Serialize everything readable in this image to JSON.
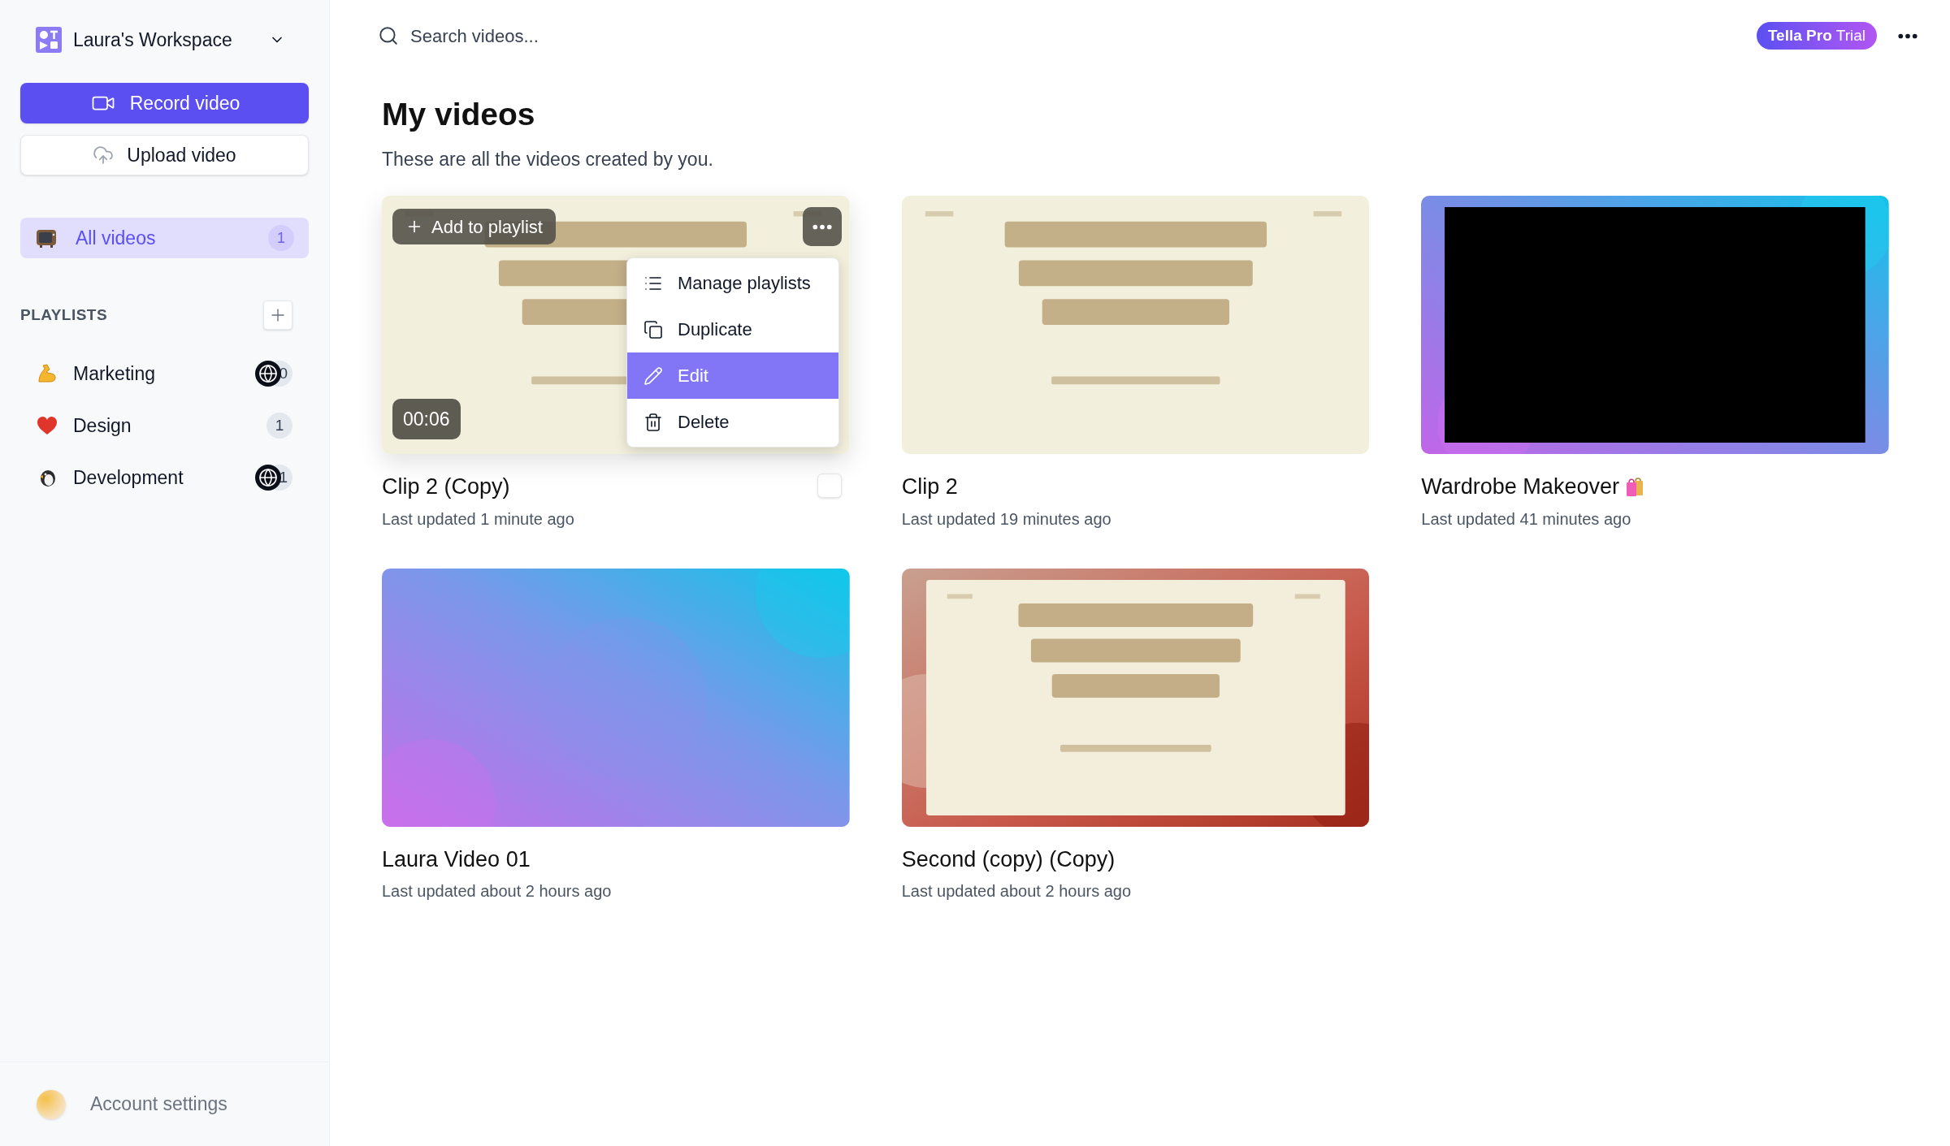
{
  "workspace": {
    "name": "Laura's Workspace"
  },
  "actions": [
    {
      "kind": "record",
      "label": "Record video"
    },
    {
      "kind": "upload",
      "label": "Upload video"
    }
  ],
  "nav": [
    {
      "kind": "tv",
      "label": "All videos",
      "count": "1",
      "selected": true
    }
  ],
  "playlists": {
    "heading": "PLAYLISTS",
    "items": [
      {
        "kind": "arm",
        "label": "Marketing",
        "count": "0",
        "shared": true
      },
      {
        "kind": "heart",
        "label": "Design",
        "count": "1",
        "shared": false
      },
      {
        "kind": "penguin",
        "label": "Development",
        "count": "1",
        "shared": true
      }
    ]
  },
  "account": {
    "label": "Account settings"
  },
  "search": {
    "placeholder": "Search videos..."
  },
  "plan_badge": {
    "strong": "Tella Pro",
    "light": "Trial"
  },
  "page": {
    "title": "My videos",
    "subtitle": "These are all the videos created by you."
  },
  "videos": [
    {
      "title": "Clip 2 (Copy)",
      "updated": "Last updated 1 minute ago",
      "thumb": {
        "kind": "slide"
      },
      "hovered": true,
      "checked": false,
      "duration": "00:06",
      "add_label": "Add to playlist",
      "menu": [
        {
          "kind": "list",
          "label": "Manage playlists",
          "selected": false
        },
        {
          "kind": "copy",
          "label": "Duplicate",
          "selected": false
        },
        {
          "kind": "pencil",
          "label": "Edit",
          "selected": true
        },
        {
          "kind": "trash",
          "label": "Delete",
          "selected": false
        }
      ]
    },
    {
      "title": "Clip 2",
      "updated": "Last updated 19 minutes ago",
      "thumb": {
        "kind": "slide"
      },
      "hovered": false
    },
    {
      "title": "Wardrobe Makeover",
      "emoji": {
        "kind": "bags"
      },
      "updated": "Last updated 41 minutes ago",
      "thumb": {
        "kind": "framed-black"
      },
      "hovered": false
    },
    {
      "title": "Laura Video 01",
      "updated": "Last updated about 2 hours ago",
      "thumb": {
        "kind": "gradient"
      },
      "hovered": false
    },
    {
      "title": "Second (copy) (Copy)",
      "updated": "Last updated about 2 hours ago",
      "thumb": {
        "kind": "framed-slide"
      },
      "hovered": false
    }
  ]
}
